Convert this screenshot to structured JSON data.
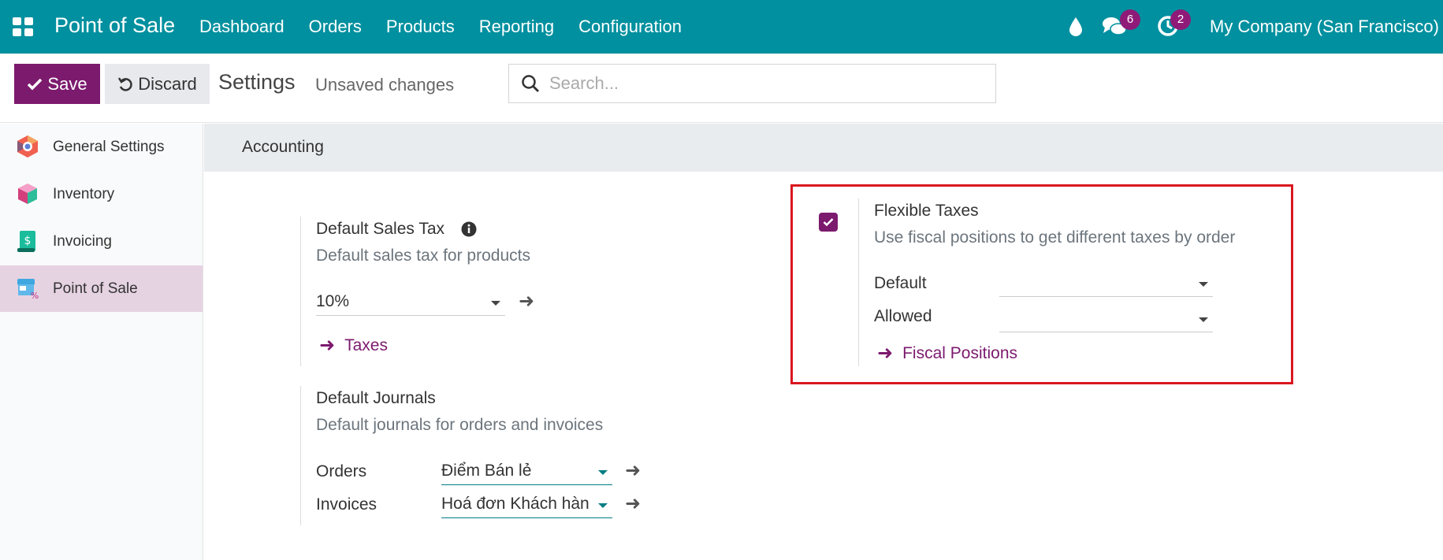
{
  "navbar": {
    "app_name": "Point of Sale",
    "menu": [
      "Dashboard",
      "Orders",
      "Products",
      "Reporting",
      "Configuration"
    ],
    "messages_count": "6",
    "activities_count": "2",
    "company": "My Company (San Francisco)",
    "bg_color": "#00909f"
  },
  "controls": {
    "save_label": "Save",
    "discard_label": "Discard",
    "title": "Settings",
    "status": "Unsaved changes",
    "search_placeholder": "Search..."
  },
  "sidebar": {
    "items": [
      {
        "label": "General Settings",
        "icon": "general-settings-icon"
      },
      {
        "label": "Inventory",
        "icon": "inventory-icon"
      },
      {
        "label": "Invoicing",
        "icon": "invoicing-icon"
      },
      {
        "label": "Point of Sale",
        "icon": "point-of-sale-icon",
        "active": true
      }
    ]
  },
  "section": {
    "title": "Accounting"
  },
  "default_sales_tax": {
    "title": "Default Sales Tax",
    "description": "Default sales tax for products",
    "value": "10%",
    "link": "Taxes"
  },
  "default_journals": {
    "title": "Default Journals",
    "description": "Default journals for orders and invoices",
    "orders_label": "Orders",
    "orders_value": "Điểm Bán lẻ",
    "invoices_label": "Invoices",
    "invoices_value": "Hoá đơn Khách hàn"
  },
  "flexible_taxes": {
    "checked": true,
    "title": "Flexible Taxes",
    "description": "Use fiscal positions to get different taxes by order",
    "default_label": "Default",
    "default_value": "",
    "allowed_label": "Allowed",
    "allowed_value": "",
    "link": "Fiscal Positions"
  },
  "colors": {
    "primary": "#7c1a6e",
    "highlight_border": "#d9171f"
  }
}
